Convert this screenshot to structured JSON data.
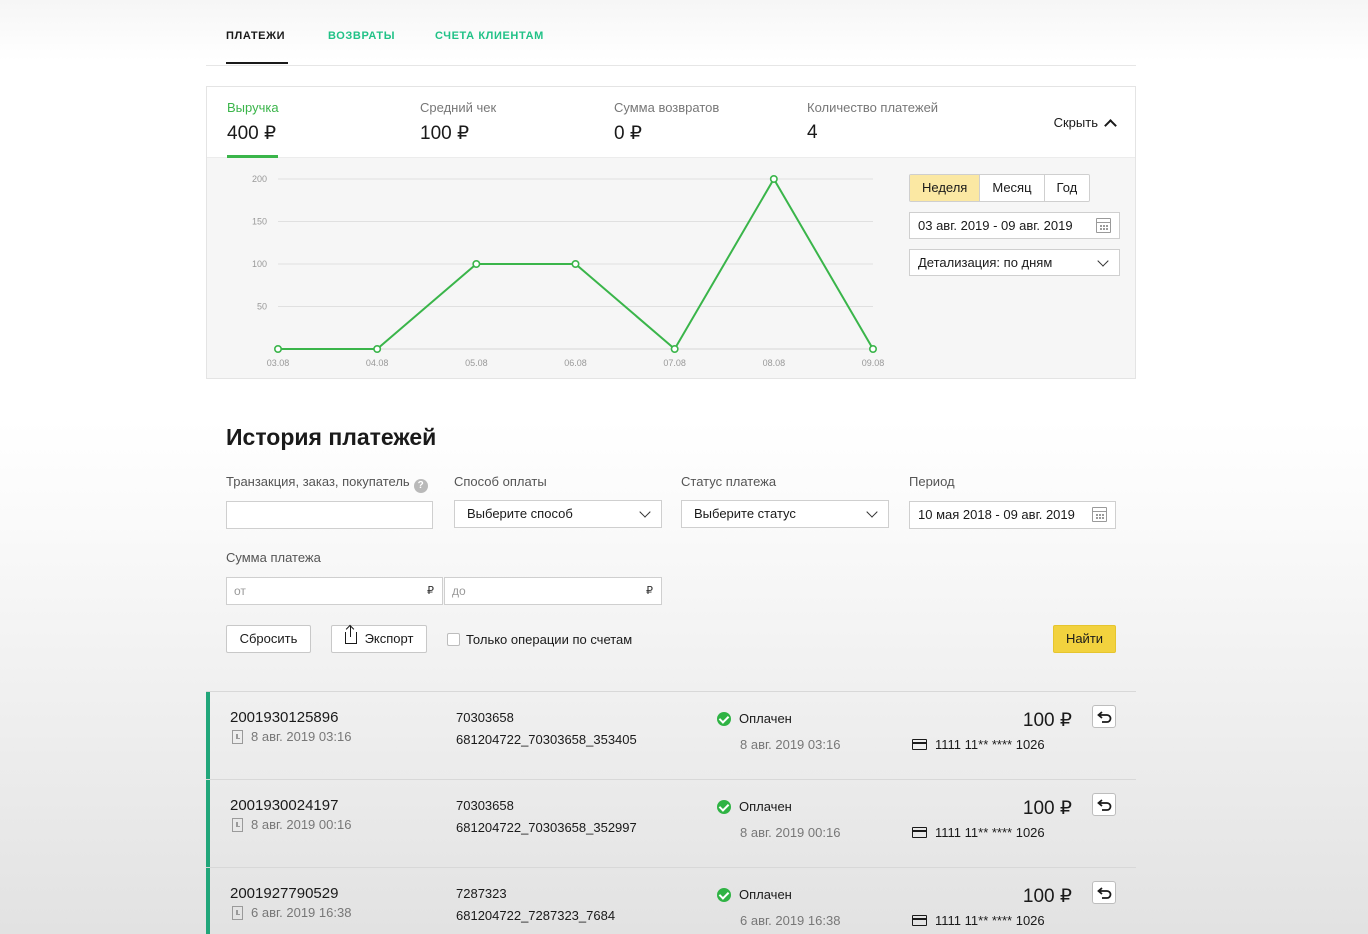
{
  "tabs": [
    {
      "label": "ПЛАТЕЖИ"
    },
    {
      "label": "ВОЗВРАТЫ"
    },
    {
      "label": "СЧЕТА КЛИЕНТАМ"
    }
  ],
  "stats": {
    "revenue": {
      "label": "Выручка",
      "value": "400 ₽"
    },
    "avg_check": {
      "label": "Средний чек",
      "value": "100 ₽"
    },
    "refunds_sum": {
      "label": "Сумма возвратов",
      "value": "0 ₽"
    },
    "payments_count": {
      "label": "Количество платежей",
      "value": "4"
    },
    "hide_label": "Скрыть"
  },
  "chart_controls": {
    "period_buttons": [
      "Неделя",
      "Месяц",
      "Год"
    ],
    "date_range": "03 авг. 2019 - 09 авг. 2019",
    "detail": "Детализация: по дням"
  },
  "chart_data": {
    "type": "line",
    "x": [
      "03.08",
      "04.08",
      "05.08",
      "06.08",
      "07.08",
      "08.08",
      "09.08"
    ],
    "series": [
      {
        "values": [
          0,
          0,
          100,
          100,
          0,
          200,
          0
        ]
      }
    ],
    "yticks": [
      50,
      100,
      150,
      200
    ],
    "ylim": [
      0,
      200
    ],
    "grid": true,
    "colors": {
      "line": "#3ab54a"
    }
  },
  "history": {
    "title": "История платежей",
    "filters": {
      "search_label": "Транзакция, заказ, покупатель",
      "method_label": "Способ оплаты",
      "method_value": "Выберите способ",
      "status_label": "Статус платежа",
      "status_value": "Выберите статус",
      "period_label": "Период",
      "period_value": "10 мая 2018 - 09 авг. 2019",
      "amount_label": "Сумма платежа",
      "amount_from_placeholder": "от",
      "amount_to_placeholder": "до",
      "currency": "₽"
    },
    "buttons": {
      "reset": "Сбросить",
      "export": "Экспорт",
      "invoices_only": "Только операции по счетам",
      "find": "Найти"
    },
    "rows": [
      {
        "id": "2001930125896",
        "date": "8 авг. 2019 03:16",
        "order": "70303658",
        "ext": "681204722_70303658_353405",
        "status": "Оплачен",
        "status_date": "8 авг. 2019 03:16",
        "amount": "100 ₽",
        "card": "1111 11** **** 1026"
      },
      {
        "id": "2001930024197",
        "date": "8 авг. 2019 00:16",
        "order": "70303658",
        "ext": "681204722_70303658_352997",
        "status": "Оплачен",
        "status_date": "8 авг. 2019 00:16",
        "amount": "100 ₽",
        "card": "1111 11** **** 1026"
      },
      {
        "id": "2001927790529",
        "date": "6 авг. 2019 16:38",
        "order": "7287323",
        "ext": "681204722_7287323_7684",
        "status": "Оплачен",
        "status_date": "6 авг. 2019 16:38",
        "amount": "100 ₽",
        "card": "1111 11** **** 1026"
      }
    ]
  },
  "colors": {
    "accent_green": "#21c287",
    "active_yellow": "#f2d23e",
    "row_bar": "#21a67a"
  }
}
